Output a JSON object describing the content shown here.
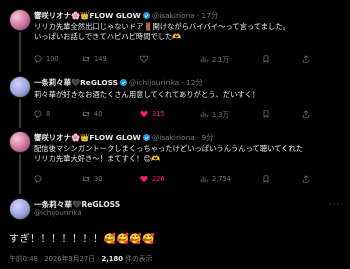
{
  "tweets": [
    {
      "name": "響咲リオナ🌸👑FLOW GLOW",
      "handle": "@isakiriona",
      "time": "· 17分",
      "body": "リリカ先輩全然出口じゃないドア🚪開けながらバイバイ〜って言ってました。\nいっぱいお話しできてハピハピ時間でした🫶",
      "replies": "100",
      "retweets": "149",
      "likes": "",
      "views": "2.1万",
      "liked": false
    },
    {
      "name": "一条莉々華🖤ReGLOSS",
      "handle": "@ichijouririka",
      "time": "· 12分",
      "body": "莉々華が好きなお酒たくさん用意してくれてありがとう、だいすく！",
      "replies": "8",
      "retweets": "40",
      "likes": "315",
      "views": "1.3万",
      "liked": true
    },
    {
      "name": "響咲リオナ🌸👑FLOW GLOW",
      "handle": "@isakiriona",
      "time": "· 9分",
      "body": "配信後マシンガントークしまくっちゃったけどいっぱいうんうんって聴いてくれた\nリリカ先輩大好き～！まてすく！😊🫶",
      "replies": "",
      "retweets": "30",
      "likes": "226",
      "views": "2,754",
      "liked": false
    }
  ],
  "main": {
    "name": "一条莉々華🖤ReGLOSS",
    "handle": "@ichijouririka",
    "body": "すぎ！！！！！！！🥰🥰🥰🥰",
    "meta_time": "午前0:48 · 2026年9月27日 · ",
    "meta_views_num": "2,180",
    "meta_views_label": " 件の表示"
  }
}
